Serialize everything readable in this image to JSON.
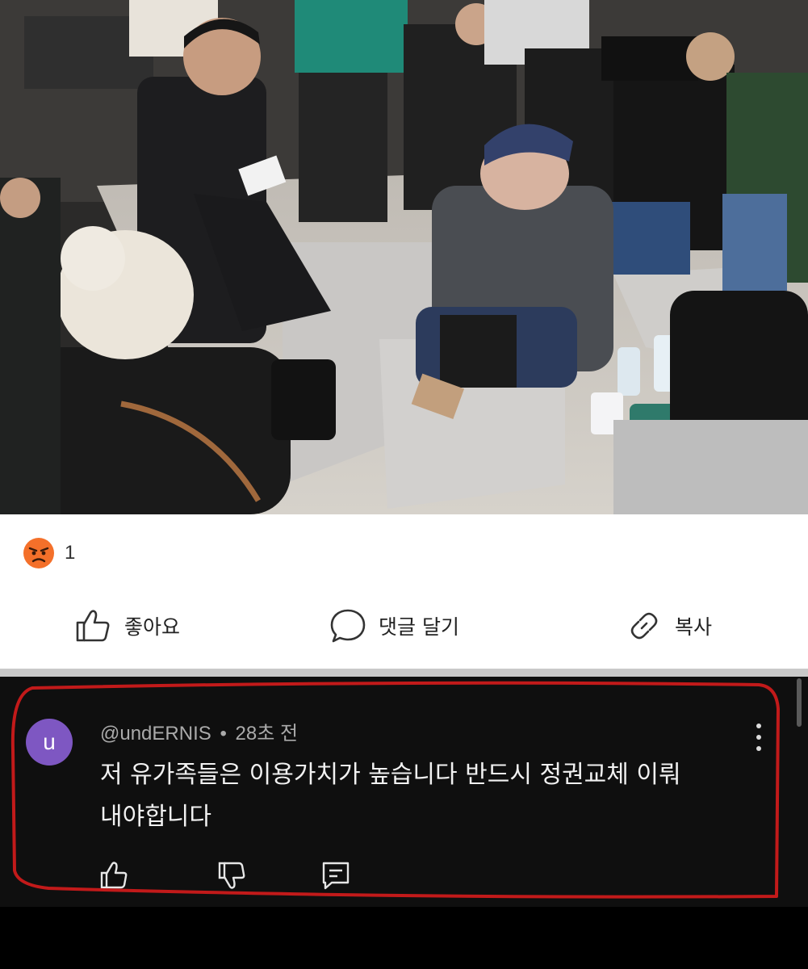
{
  "post": {
    "reaction": {
      "icon": "angry-face-icon",
      "count": "1"
    },
    "actions": [
      {
        "icon": "thumbs-up-icon",
        "label": "좋아요"
      },
      {
        "icon": "comment-bubble-icon",
        "label": "댓글 달기"
      },
      {
        "icon": "link-icon",
        "label": "복사"
      }
    ]
  },
  "comment": {
    "avatar_letter": "u",
    "author": "@undERNIS",
    "separator": "•",
    "time": "28초 전",
    "text_line1": "저 유가족들은 이용가치가 높습니다 반드시 정권교체 이뤄",
    "text_line2": "내야합니다",
    "icons": [
      "thumbs-up-icon",
      "thumbs-down-icon",
      "reply-icon",
      "more-vert-icon"
    ]
  },
  "colors": {
    "avatar": "#7e57c2",
    "highlight_outline": "#c21a1a",
    "comment_bg": "#0f0f0f",
    "angry_emoji": "#f4702a"
  }
}
